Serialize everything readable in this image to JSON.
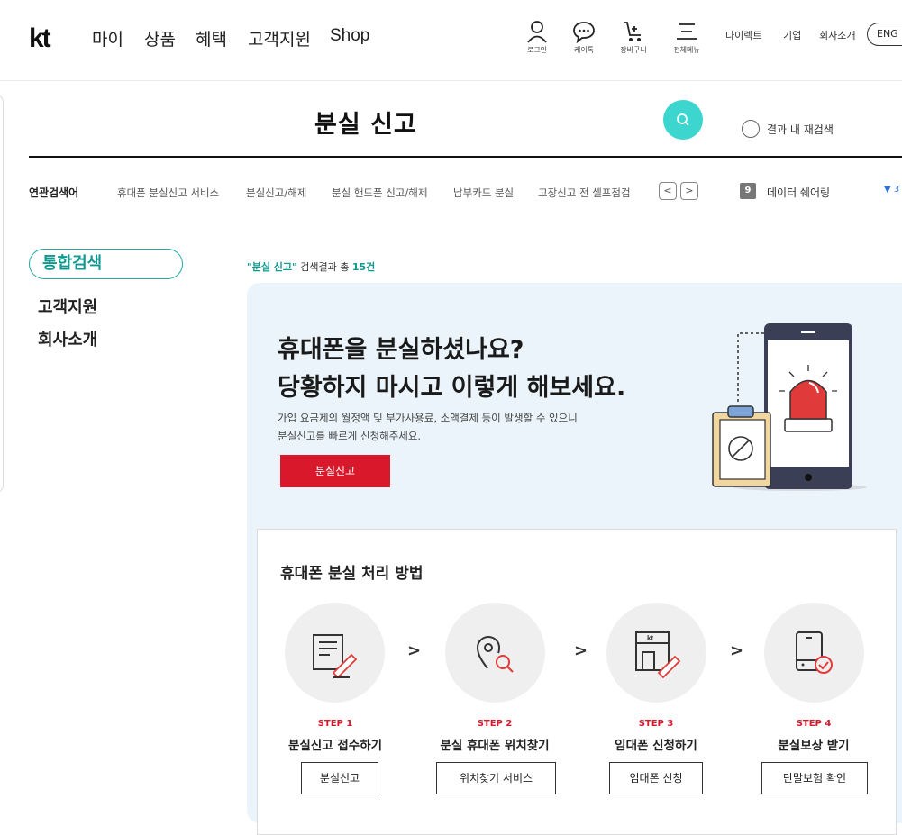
{
  "header": {
    "logo": "kt",
    "gnb": [
      "마이",
      "상품",
      "혜택",
      "고객지원",
      "Shop"
    ],
    "utils": [
      {
        "label": "로그인",
        "icon": "person-icon"
      },
      {
        "label": "케이톡",
        "icon": "chat-bubble-icon"
      },
      {
        "label": "장바구니",
        "icon": "cart-icon"
      },
      {
        "label": "전체메뉴",
        "icon": "menu-icon"
      }
    ],
    "toplinks": [
      "다이렉트",
      "기업",
      "회사소개"
    ],
    "lang": "ENG"
  },
  "search": {
    "query": "분실 신고",
    "recheck_label": "결과 내 재검색"
  },
  "related": {
    "title": "연관검색어",
    "items": [
      "휴대폰 분실신고 서비스",
      "분실신고/해제",
      "분실 핸드폰 신고/해제",
      "납부카드 분실",
      "고장신고 전 셀프점검"
    ],
    "prev": "<",
    "next": ">"
  },
  "ranking": {
    "rank": "9",
    "keyword": "데이터 쉐어링",
    "trend": "▼ 3"
  },
  "nav": {
    "items": [
      "통합검색",
      "고객지원",
      "회사소개"
    ]
  },
  "result": {
    "keyword": "\"분실 신고\"",
    "middle": " 검색결과 총 ",
    "count": "15건"
  },
  "banner": {
    "title1": "휴대폰을 분실하셨나요?",
    "title2": "당황하지 마시고 이렇게 해보세요.",
    "desc1": "가입 요금제의 월정액 및 부가사용료, 소액결제 등이 발생할 수 있으니",
    "desc2": "분실신고를 빠르게 신청해주세요.",
    "button": "분실신고"
  },
  "process": {
    "title": "휴대폰 분실 처리 방법",
    "steps": [
      {
        "no": "STEP 1",
        "name": "분실신고 접수하기",
        "button": "분실신고",
        "icon": "clipboard-pen-icon"
      },
      {
        "no": "STEP 2",
        "name": "분실 휴대폰 위치찾기",
        "button": "위치찾기 서비스",
        "icon": "location-search-icon"
      },
      {
        "no": "STEP 3",
        "name": "임대폰 신청하기",
        "button": "임대폰 신청",
        "icon": "kt-store-icon"
      },
      {
        "no": "STEP 4",
        "name": "분실보상 받기",
        "button": "단말보험 확인",
        "icon": "phone-check-icon"
      }
    ],
    "arrow": ">"
  },
  "colors": {
    "accent": "#11988f",
    "search_button": "#3cd6cf",
    "red": "#d9192b",
    "banner_bg": "#eaf4fa"
  }
}
